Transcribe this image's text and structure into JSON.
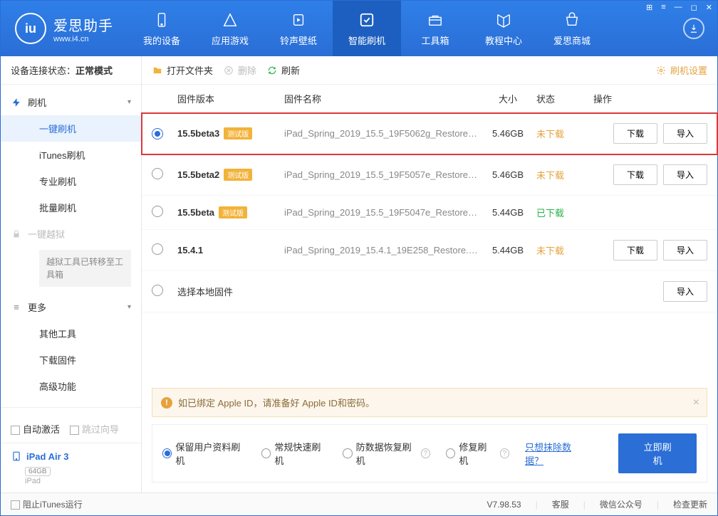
{
  "app": {
    "name": "爱思助手",
    "url": "www.i4.cn"
  },
  "nav": {
    "items": [
      {
        "label": "我的设备"
      },
      {
        "label": "应用游戏"
      },
      {
        "label": "铃声壁纸"
      },
      {
        "label": "智能刷机"
      },
      {
        "label": "工具箱"
      },
      {
        "label": "教程中心"
      },
      {
        "label": "爱思商城"
      }
    ]
  },
  "sidebar": {
    "status_label": "设备连接状态：",
    "status_value": "正常模式",
    "groups": {
      "flash": {
        "label": "刷机",
        "children": [
          "一键刷机",
          "iTunes刷机",
          "专业刷机",
          "批量刷机"
        ]
      },
      "jailbreak": {
        "label": "一键越狱",
        "note": "越狱工具已转移至工具箱"
      },
      "more": {
        "label": "更多",
        "children": [
          "其他工具",
          "下载固件",
          "高级功能"
        ]
      }
    },
    "auto_activate": "自动激活",
    "skip_guide": "跳过向导",
    "device": {
      "name": "iPad Air 3",
      "storage": "64GB",
      "type": "iPad"
    }
  },
  "toolbar": {
    "open": "打开文件夹",
    "delete": "删除",
    "refresh": "刷新",
    "settings": "刷机设置"
  },
  "table": {
    "headers": {
      "version": "固件版本",
      "name": "固件名称",
      "size": "大小",
      "status": "状态",
      "ops": "操作"
    },
    "rows": [
      {
        "version": "15.5beta3",
        "beta": "测试版",
        "name": "iPad_Spring_2019_15.5_19F5062g_Restore.ip...",
        "size": "5.46GB",
        "status": "未下载",
        "status_cls": "st-orange",
        "selected": true,
        "download": true,
        "import": true
      },
      {
        "version": "15.5beta2",
        "beta": "测试版",
        "name": "iPad_Spring_2019_15.5_19F5057e_Restore.ip...",
        "size": "5.46GB",
        "status": "未下载",
        "status_cls": "st-orange",
        "selected": false,
        "download": true,
        "import": true
      },
      {
        "version": "15.5beta",
        "beta": "测试版",
        "name": "iPad_Spring_2019_15.5_19F5047e_Restore.ip...",
        "size": "5.44GB",
        "status": "已下载",
        "status_cls": "st-green",
        "selected": false,
        "download": false,
        "import": false
      },
      {
        "version": "15.4.1",
        "beta": "",
        "name": "iPad_Spring_2019_15.4.1_19E258_Restore.ipsw",
        "size": "5.44GB",
        "status": "未下载",
        "status_cls": "st-orange",
        "selected": false,
        "download": true,
        "import": true
      }
    ],
    "local_row": "选择本地固件",
    "btn_download": "下载",
    "btn_import": "导入"
  },
  "warn": "如已绑定 Apple ID，请准备好 Apple ID和密码。",
  "flash_opts": {
    "opts": [
      "保留用户资料刷机",
      "常规快速刷机",
      "防数据恢复刷机",
      "修复刷机"
    ],
    "erase_link": "只想抹除数据？",
    "go": "立即刷机"
  },
  "statusbar": {
    "block_itunes": "阻止iTunes运行",
    "version": "V7.98.53",
    "support": "客服",
    "wechat": "微信公众号",
    "update": "检查更新"
  }
}
